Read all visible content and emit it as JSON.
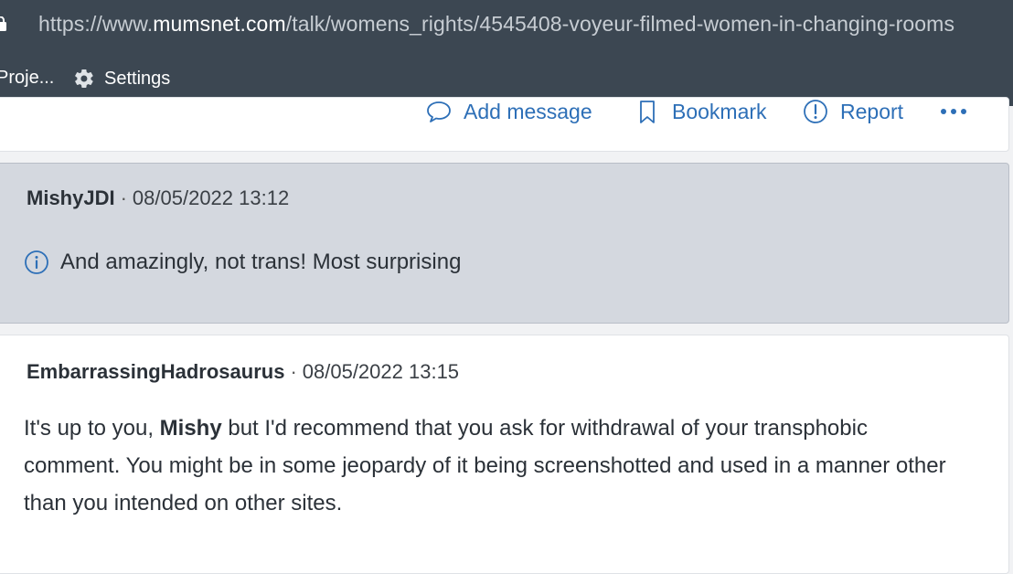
{
  "browser": {
    "url_prefix": "https://www.",
    "url_host": "mumsnet.com",
    "url_path": "/talk/womens_rights/4545408-voyeur-filmed-women-in-changing-rooms",
    "bookmarks": [
      {
        "label": "Proje..."
      },
      {
        "label": "Settings",
        "icon": "gear-icon"
      }
    ]
  },
  "actions": {
    "add_message": "Add message",
    "bookmark": "Bookmark",
    "report": "Report"
  },
  "posts": [
    {
      "username": "MishyJDI",
      "separator": "·",
      "timestamp": "08/05/2022 13:12",
      "notice": "And amazingly, not trans! Most surprising",
      "icon": "info-icon"
    },
    {
      "username": "EmbarrassingHadrosaurus",
      "separator": "·",
      "timestamp": "08/05/2022 13:15",
      "body_part1": "It's up to you, ",
      "body_bold": "Mishy",
      "body_part2": " but I'd recommend that you ask for withdrawal of your transphobic comment. You might be in some jeopardy of it being screenshotted and used in a manner other than you intended on other sites."
    }
  ],
  "colors": {
    "chrome_bg": "#3c4752",
    "link_blue": "#2d6fb7",
    "hidden_post_bg": "#d4d8df"
  }
}
